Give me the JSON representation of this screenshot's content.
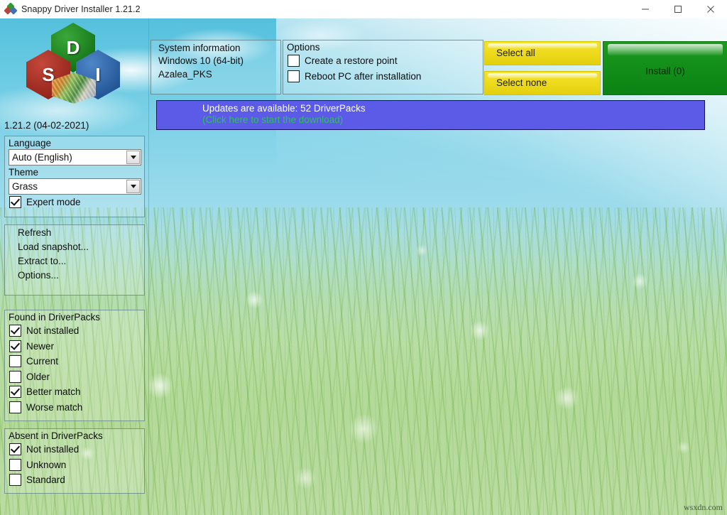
{
  "window": {
    "title": "Snappy Driver Installer 1.21.2",
    "app_icon": "sdi-logo-icon",
    "controls": {
      "minimize": "minimize-icon",
      "maximize": "maximize-icon",
      "close": "close-icon"
    }
  },
  "logo": {
    "letter_d": "D",
    "letter_s": "S",
    "letter_i": "I"
  },
  "version_text": "1.21.2 (04-02-2021)",
  "language_panel": {
    "language_label": "Language",
    "language_value": "Auto (English)",
    "theme_label": "Theme",
    "theme_value": "Grass",
    "expert_mode_label": "Expert mode",
    "expert_mode_checked": true
  },
  "menu": {
    "items": [
      {
        "label": "Refresh"
      },
      {
        "label": "Load snapshot..."
      },
      {
        "label": "Extract to..."
      },
      {
        "label": "Options..."
      }
    ]
  },
  "found_in_driverpacks": {
    "title": "Found in DriverPacks",
    "items": [
      {
        "label": "Not installed",
        "checked": true
      },
      {
        "label": "Newer",
        "checked": true
      },
      {
        "label": "Current",
        "checked": false
      },
      {
        "label": "Older",
        "checked": false
      },
      {
        "label": "Better match",
        "checked": true
      },
      {
        "label": "Worse match",
        "checked": false
      }
    ]
  },
  "absent_in_driverpacks": {
    "title": "Absent in DriverPacks",
    "items": [
      {
        "label": "Not installed",
        "checked": true
      },
      {
        "label": "Unknown",
        "checked": false
      },
      {
        "label": "Standard",
        "checked": false
      }
    ]
  },
  "system_information": {
    "title": "System information",
    "os": "Windows 10 (64-bit)",
    "machine": "Azalea_PKS"
  },
  "options": {
    "title": "Options",
    "items": [
      {
        "label": "Create a restore point",
        "checked": false
      },
      {
        "label": "Reboot PC after installation",
        "checked": false
      }
    ]
  },
  "actions": {
    "select_all": "Select all",
    "select_none": "Select none",
    "install": "Install (0)"
  },
  "update_banner": {
    "line1": "Updates are available: 52 DriverPacks",
    "line2": "(Click here to start the download)",
    "background": "#5b5be8",
    "line1_color": "#ffffff",
    "line2_color": "#2fbf5a"
  },
  "watermark": "wsxdn.com"
}
